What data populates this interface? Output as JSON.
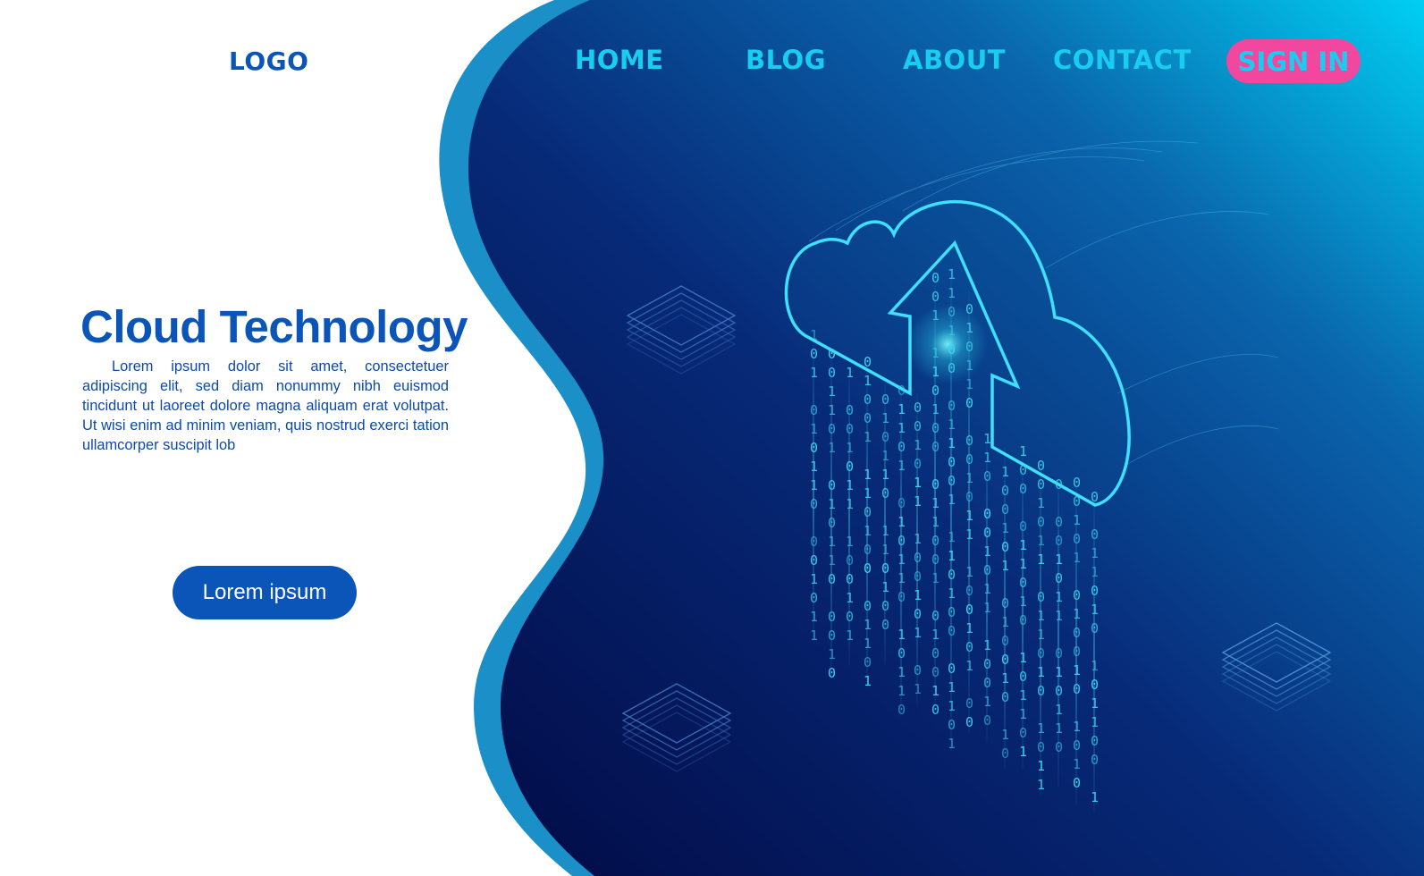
{
  "header": {
    "logo": "LOGO",
    "nav": [
      {
        "label": "HOME"
      },
      {
        "label": "BLOG"
      },
      {
        "label": "ABOUT"
      },
      {
        "label": "CONTACT"
      }
    ],
    "sign_in_label": "SIGN IN"
  },
  "hero": {
    "title": "Cloud Technology",
    "body": "Lorem ipsum dolor sit amet, consectetuer adipiscing elit, sed diam nonummy nibh euismod tincidunt ut laoreet dolore magna aliquam erat volutpat. Ut wisi enim ad minim veniam, quis nostrud exerci tation ullamcorper suscipit lob",
    "cta_label": "Lorem ipsum"
  },
  "illustration": {
    "subject": "cloud-upload",
    "binary_stream": "1010010110100101100110100101101001011001011010010110100101"
  },
  "colors": {
    "brand_blue": "#0b55b8",
    "nav_cyan": "#19cdf0",
    "sign_in_pink": "#f2479e",
    "panel_dark": "#020c4a",
    "panel_light": "#00c8f0",
    "wave_edge": "#1a8fc8"
  }
}
